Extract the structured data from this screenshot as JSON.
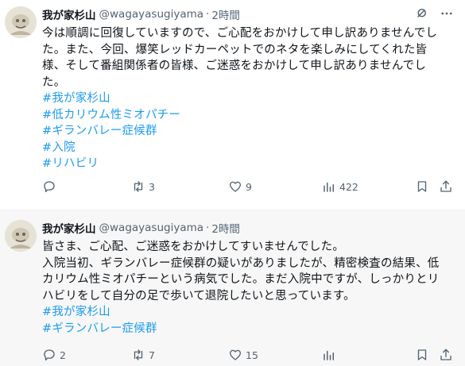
{
  "tweets": [
    {
      "display_name": "我が家杉山",
      "handle": "@wagayasugiyama",
      "separator": "·",
      "time": "2時間",
      "body_lines": [
        "今は順調に回復していますので、ご心配をおかけして申し訳ありませんでし",
        "た。また、今回、爆笑レッドカーペットでのネタを楽しみにしてくれた皆",
        "様、そして番組関係者の皆様、ご迷惑をおかけして申し訳ありませんでし",
        "た。"
      ],
      "hashtags": [
        "#我が家杉山",
        "#低カリウム性ミオパチー",
        "#ギランバレー症候群",
        "#入院",
        "#リハビリ"
      ],
      "stats": {
        "replies": "",
        "retweets": "3",
        "likes": "9",
        "views": "422"
      }
    },
    {
      "display_name": "我が家杉山",
      "handle": "@wagayasugiyama",
      "separator": "·",
      "time": "2時間",
      "body_lines": [
        "皆さま、ご心配、ご迷惑をおかけしてすいませんでした。",
        "入院当初、ギランバレー症候群の疑いがありましたが、精密検査の結果、低",
        "カリウム性ミオパチーという病気でした。まだ入院中ですが、しっかりとリ",
        "ハビリをして自分の足で歩いて退院したいと思っています。"
      ],
      "hashtags": [
        "#我が家杉山",
        "#ギランバレー症候群"
      ],
      "stats": {
        "replies": "2",
        "retweets": "7",
        "likes": "15",
        "views": ""
      }
    }
  ],
  "icons": {
    "avatar": "avatar-illustration",
    "grok": "grok-icon",
    "more": "more-icon",
    "reply": "reply-icon",
    "retweet": "retweet-icon",
    "like": "heart-icon",
    "views": "views-icon",
    "bookmark": "bookmark-icon",
    "share": "share-icon"
  },
  "colors": {
    "text": "#0f1419",
    "secondary": "#536471",
    "link": "#1d9bf0",
    "hover_bg": "#f7f7f7"
  }
}
